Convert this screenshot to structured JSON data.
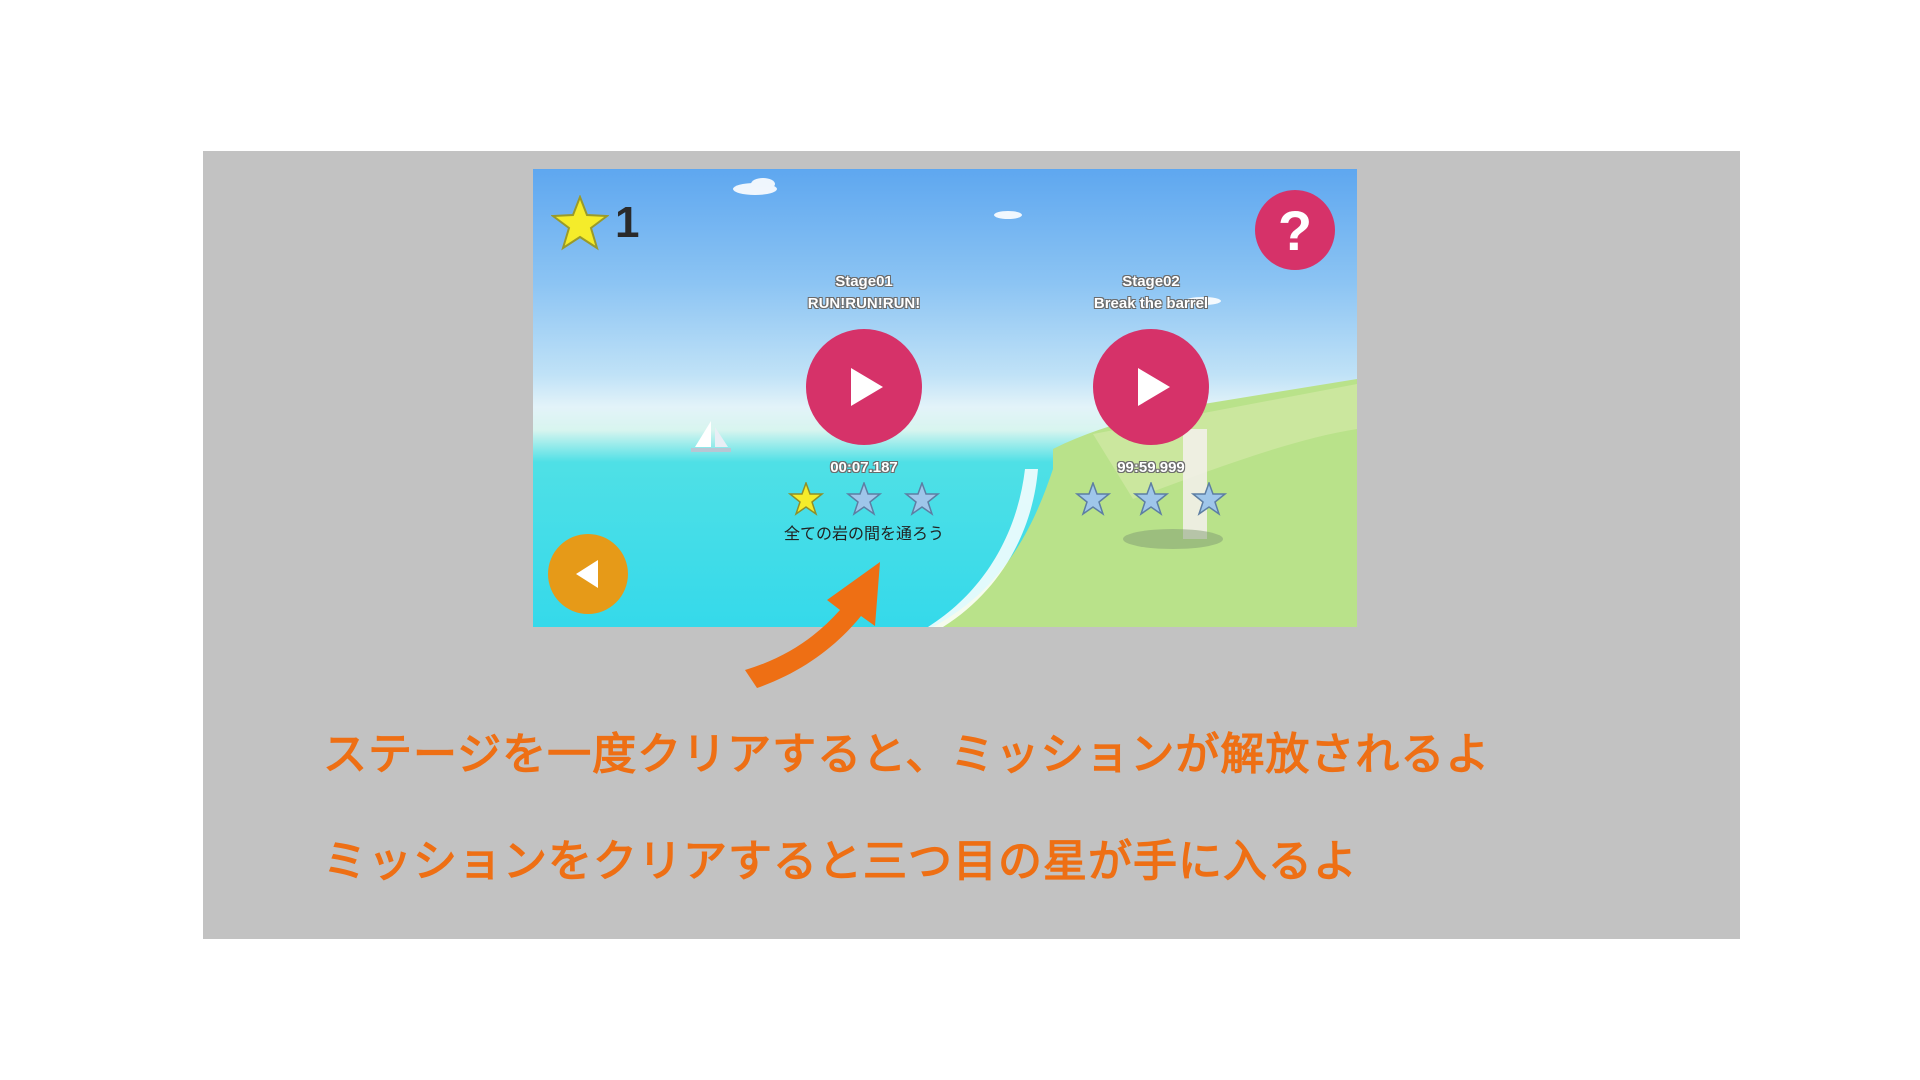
{
  "hud": {
    "star_total": "1",
    "help_label": "?"
  },
  "stages": [
    {
      "name": "Stage01",
      "subtitle": "RUN!RUN!RUN!",
      "time": "00:07.187",
      "stars_earned": 1,
      "mission": "全ての岩の間を通ろう"
    },
    {
      "name": "Stage02",
      "subtitle": "Break the barrel",
      "time": "99:59.999",
      "stars_earned": 0
    }
  ],
  "captions": [
    "ステージを一度クリアすると、ミッションが解放されるよ",
    "ミッションをクリアすると三つ目の星が手に入るよ"
  ],
  "colors": {
    "play_button": "#d63269",
    "help_button": "#d63269",
    "back_button": "#e69a18",
    "caption_text": "#ee6f14",
    "star_earned": "#f5ec2a",
    "star_empty": "#9fc6ea"
  },
  "icons": {
    "hud_star": "star-icon",
    "play": "play-icon",
    "back": "back-arrow-icon",
    "help": "question-icon",
    "pointer": "pointer-arrow-icon"
  }
}
